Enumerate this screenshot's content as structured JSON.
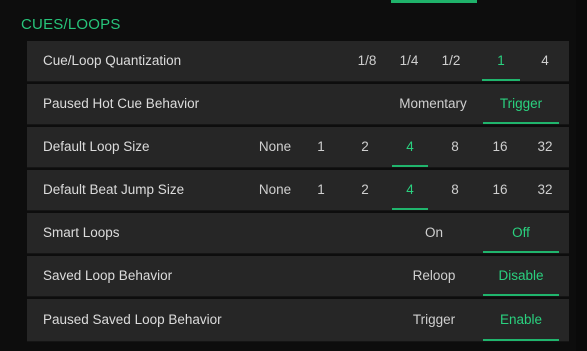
{
  "section": {
    "title": "CUES/LOOPS"
  },
  "rows": [
    {
      "label": "Cue/Loop Quantization",
      "options": [
        "1/8",
        "1/4",
        "1/2",
        "1",
        "4"
      ],
      "selected": 3
    },
    {
      "label": "Paused Hot Cue Behavior",
      "options": [
        "Momentary",
        "Trigger"
      ],
      "selected": 1
    },
    {
      "label": "Default Loop Size",
      "options": [
        "None",
        "1",
        "2",
        "4",
        "8",
        "16",
        "32"
      ],
      "selected": 3
    },
    {
      "label": "Default Beat Jump Size",
      "options": [
        "None",
        "1",
        "2",
        "4",
        "8",
        "16",
        "32"
      ],
      "selected": 3
    },
    {
      "label": "Smart Loops",
      "options": [
        "On",
        "Off"
      ],
      "selected": 1
    },
    {
      "label": "Saved Loop Behavior",
      "options": [
        "Reloop",
        "Disable"
      ],
      "selected": 1
    },
    {
      "label": "Paused Saved Loop Behavior",
      "options": [
        "Trigger",
        "Enable"
      ],
      "selected": 1
    }
  ],
  "colors": {
    "accent": "#2ad17f",
    "row_background": "#262626",
    "background": "#0d0d0d"
  }
}
